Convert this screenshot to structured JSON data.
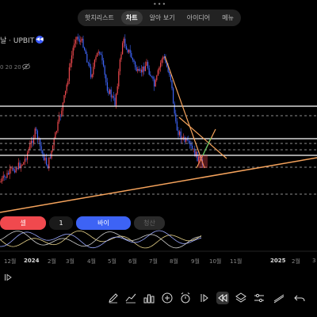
{
  "tabs": [
    {
      "label": "핫치리스트",
      "active": false
    },
    {
      "label": "차트",
      "active": true
    },
    {
      "label": "알아 보기",
      "active": false
    },
    {
      "label": "아이디어",
      "active": false
    },
    {
      "label": "메뉴",
      "active": false
    }
  ],
  "symbol": {
    "text": "날 · UPBIT",
    "subtitle": "0 20 20"
  },
  "order": {
    "sell_label": "셀",
    "quantity": "1",
    "buy_label": "바이",
    "close_label": "청산"
  },
  "time_axis": [
    {
      "label": "12월",
      "bold": false
    },
    {
      "label": "2024",
      "bold": true
    },
    {
      "label": "2월",
      "bold": false
    },
    {
      "label": "3월",
      "bold": false
    },
    {
      "label": "4월",
      "bold": false
    },
    {
      "label": "5월",
      "bold": false
    },
    {
      "label": "6월",
      "bold": false
    },
    {
      "label": "7월",
      "bold": false
    },
    {
      "label": "8월",
      "bold": false
    },
    {
      "label": "9월",
      "bold": false
    },
    {
      "label": "10월",
      "bold": false
    },
    {
      "label": "11월",
      "bold": false
    },
    {
      "label": "2025",
      "bold": true
    },
    {
      "label": "2월",
      "bold": false
    },
    {
      "label": "3",
      "bold": false
    }
  ],
  "toolbar": [
    "pen-icon",
    "indicators-icon",
    "templates-icon",
    "add-icon",
    "alert-icon",
    "replay-icon",
    "rewind-icon",
    "layers-icon",
    "compare-icon",
    "drawings-icon",
    "undo-icon",
    "redo-icon"
  ],
  "colors": {
    "up": "#f0494e",
    "down": "#3d63f5",
    "trendline": "#f5a35c",
    "accent": "#3d63f5",
    "level_line": "#ffffff"
  }
}
